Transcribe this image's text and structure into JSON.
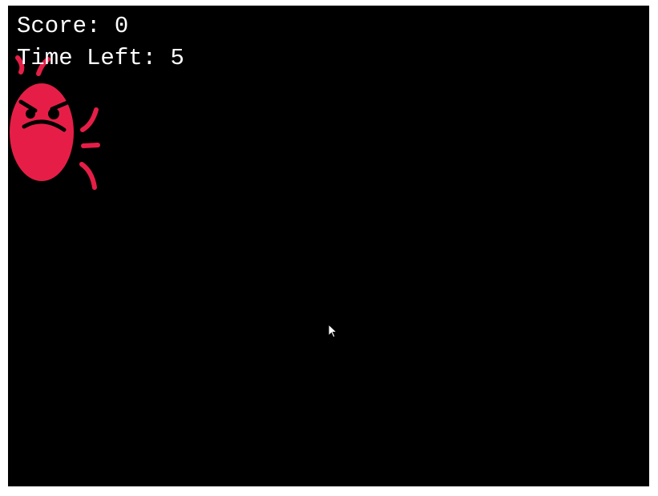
{
  "hud": {
    "score_label": "Score:",
    "score_value": "0",
    "time_label": "Time Left:",
    "time_value": "5"
  },
  "colors": {
    "background": "#000000",
    "text": "#ffffff",
    "bug": "#e61e47"
  },
  "sprites": {
    "target": "angry-bug-icon",
    "pointer": "mouse-cursor-icon"
  }
}
